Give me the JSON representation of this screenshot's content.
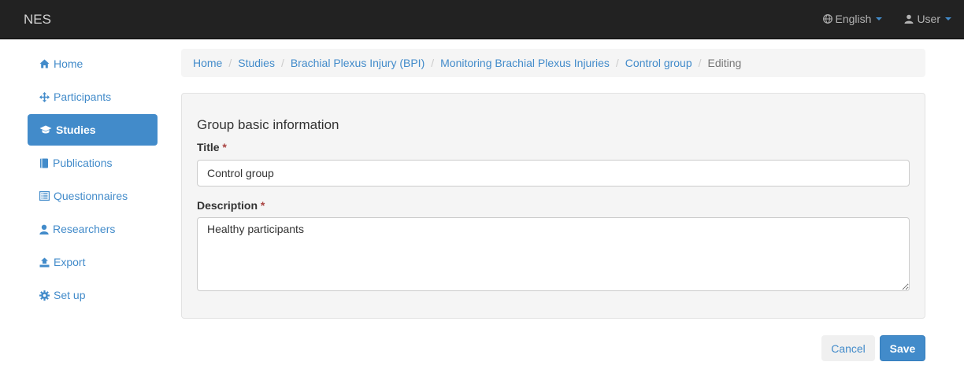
{
  "navbar": {
    "brand": "NES",
    "language": "English",
    "user": "User"
  },
  "sidebar": {
    "items": [
      {
        "label": "Home",
        "icon": "home-icon"
      },
      {
        "label": "Participants",
        "icon": "move-icon"
      },
      {
        "label": "Studies",
        "icon": "education-icon",
        "active": true
      },
      {
        "label": "Publications",
        "icon": "book-icon"
      },
      {
        "label": "Questionnaires",
        "icon": "list-alt-icon"
      },
      {
        "label": "Researchers",
        "icon": "user-icon"
      },
      {
        "label": "Export",
        "icon": "export-icon"
      },
      {
        "label": "Set up",
        "icon": "cog-icon"
      }
    ]
  },
  "breadcrumb": [
    "Home",
    "Studies",
    "Brachial Plexus Injury (BPI)",
    "Monitoring Brachial Plexus Injuries",
    "Control group",
    "Editing"
  ],
  "form": {
    "section_title": "Group basic information",
    "title_label": "Title",
    "title_value": "Control group",
    "description_label": "Description",
    "description_value": "Healthy participants",
    "required_marker": "*"
  },
  "actions": {
    "cancel": "Cancel",
    "save": "Save"
  },
  "colors": {
    "navbar_bg": "#222222",
    "link": "#428bca",
    "active_bg": "#428bca",
    "required": "#a94442"
  }
}
